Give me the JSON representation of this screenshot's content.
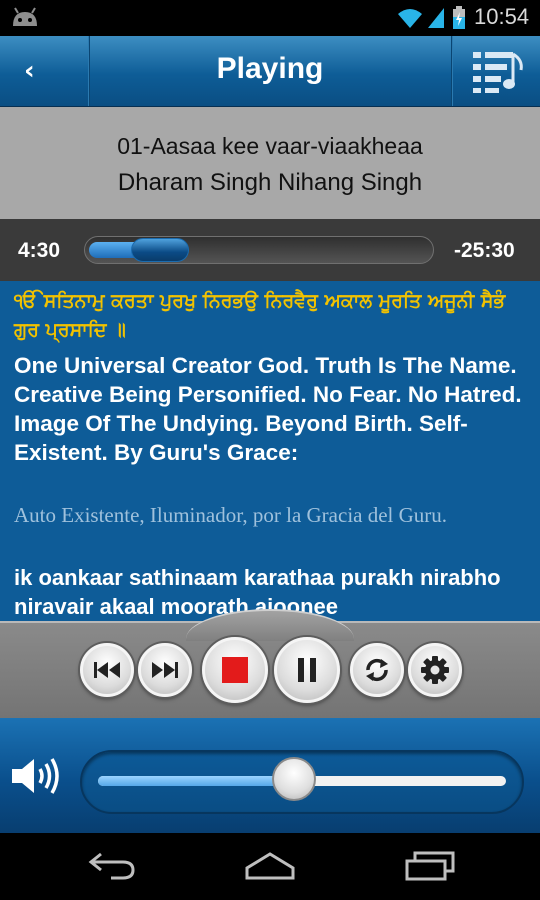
{
  "status_bar": {
    "time": "10:54",
    "icons": [
      "android-icon",
      "wifi-icon",
      "signal-icon",
      "battery-charging-icon"
    ]
  },
  "title_bar": {
    "back_icon": "chevron-left-icon",
    "title": "Playing",
    "menu_icon": "playlist-music-icon"
  },
  "track": {
    "name": "01-Aasaa kee vaar-viaakheaa",
    "artist": "Dharam Singh Nihang Singh"
  },
  "progress": {
    "elapsed": "4:30",
    "remaining": "-25:30",
    "fraction": 0.15
  },
  "lyrics": {
    "gurmukhi": "ੴ ਸਤਿਨਾਮੁ ਕਰਤਾ ਪੁਰਖੁ ਨਿਰਭਉ ਨਿਰਵੈਰੁ ਅਕਾਲ ਮੂਰਤਿ ਅਜੂਨੀ ਸੈਭੰ ਗੁਰ ਪ੍ਰਸਾਦਿ ॥",
    "english": "One Universal Creator God. Truth Is The Name. Creative Being Personified. No Fear. No Hatred. Image Of The Undying. Beyond Birth. Self-Existent. By Guru's Grace:",
    "spanish": "Auto Existente, Iluminador, por la Gracia del Guru.",
    "transliteration": "ik oankaar sathinaam karathaa purakh nirabho niravair akaal moorath ajoonee"
  },
  "controls": {
    "buttons": [
      {
        "name": "previous-button",
        "icon": "skip-previous-icon"
      },
      {
        "name": "next-button",
        "icon": "skip-next-icon"
      },
      {
        "name": "stop-button",
        "icon": "stop-icon"
      },
      {
        "name": "pause-button",
        "icon": "pause-icon"
      },
      {
        "name": "repeat-button",
        "icon": "repeat-icon"
      },
      {
        "name": "settings-button",
        "icon": "gear-icon"
      }
    ]
  },
  "volume": {
    "icon": "speaker-volume-icon",
    "level": 0.48
  },
  "colors": {
    "title_bar": "#0e5d97",
    "lyrics_bg": "#0e5c98",
    "gurmukhi_text": "#f2c200",
    "stop_red": "#e31b1b"
  },
  "nav_bar": {
    "icons": [
      "back-arrow-icon",
      "home-icon",
      "recent-apps-icon"
    ]
  }
}
